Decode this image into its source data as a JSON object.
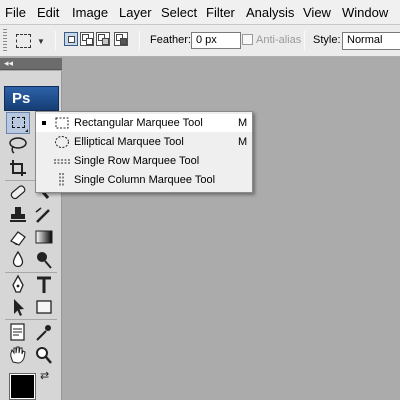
{
  "menubar": {
    "items": [
      "File",
      "Edit",
      "Image",
      "Layer",
      "Select",
      "Filter",
      "Analysis",
      "View",
      "Window"
    ]
  },
  "options": {
    "feather_label": "Feather:",
    "feather_value": "0 px",
    "antialias_label": "Anti-alias",
    "style_label": "Style:",
    "style_value": "Normal"
  },
  "toolbox": {
    "logo": "Ps"
  },
  "flyout": {
    "items": [
      {
        "label": "Rectangular Marquee Tool",
        "shortcut": "M",
        "icon": "rectangular-marquee-icon",
        "selected": true
      },
      {
        "label": "Elliptical Marquee Tool",
        "shortcut": "M",
        "icon": "elliptical-marquee-icon",
        "selected": false
      },
      {
        "label": "Single Row Marquee Tool",
        "shortcut": "",
        "icon": "single-row-marquee-icon",
        "selected": false
      },
      {
        "label": "Single Column Marquee Tool",
        "shortcut": "",
        "icon": "single-column-marquee-icon",
        "selected": false
      }
    ]
  },
  "colors": {
    "canvas": "#ababab",
    "menubar": "#f0f0f0",
    "logo": "#1f4f8f",
    "selection_highlight": "#b7c8df"
  }
}
